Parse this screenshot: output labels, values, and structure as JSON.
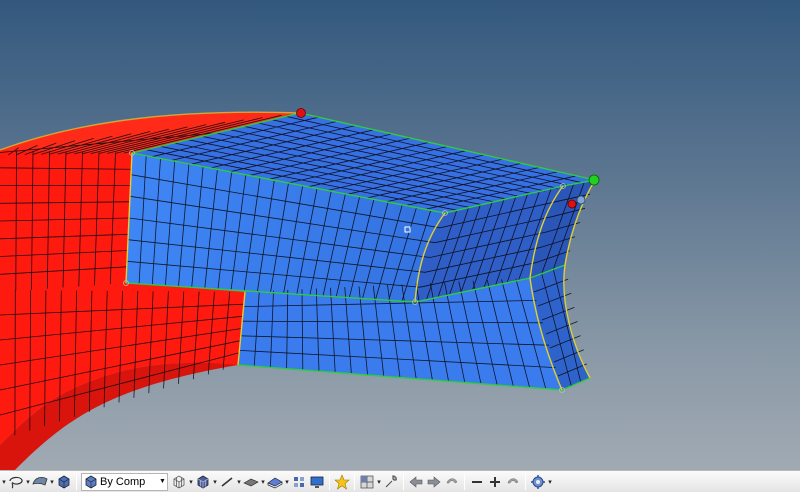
{
  "toolbar": {
    "display_mode_select": {
      "value": "By Comp"
    }
  },
  "icons": [
    "lasso-icon",
    "view-cube-icon",
    "component-color-icon",
    "wireframe-cube-icon",
    "shaded-cube-icon",
    "line-style-icon",
    "plane-icon",
    "surface-icon",
    "grid-layout-icon",
    "monitor-icon",
    "star-icon",
    "mesh-icon",
    "wrench-icon",
    "arrow-left-icon",
    "arrow-right-icon",
    "undo-icon",
    "zoom-out-icon",
    "zoom-in-icon",
    "rotate-icon",
    "settings-icon"
  ],
  "colors": {
    "mesh_blue": "#3d7ff0",
    "mesh_blue_dark": "#2b5cc2",
    "mesh_red": "#ff1a10",
    "edge_green": "#2ecc40",
    "edge_yellow": "#e0d030",
    "node_red": "#e01010",
    "node_green": "#20d020",
    "node_blue": "#6aa0d8"
  }
}
